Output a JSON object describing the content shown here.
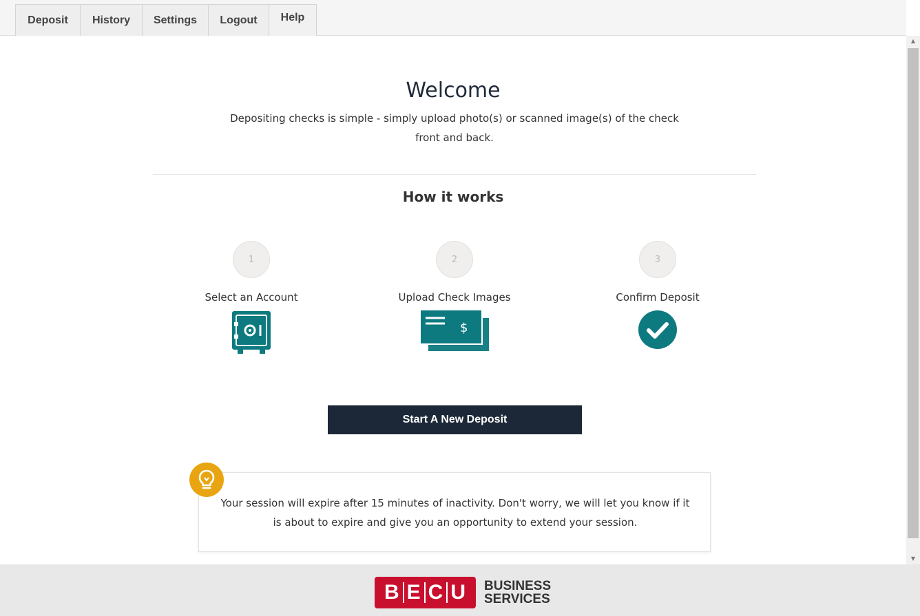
{
  "nav": {
    "tabs": [
      {
        "label": "Deposit"
      },
      {
        "label": "History"
      },
      {
        "label": "Settings"
      },
      {
        "label": "Logout"
      },
      {
        "label": "Help"
      }
    ]
  },
  "welcome": {
    "title": "Welcome",
    "text": "Depositing checks is simple - simply upload photo(s) or scanned image(s) of the check front and back."
  },
  "how_it_works": {
    "title": "How it works",
    "steps": [
      {
        "number": "1",
        "label": "Select an Account",
        "icon": "safe-icon"
      },
      {
        "number": "2",
        "label": "Upload Check Images",
        "icon": "check-images-icon"
      },
      {
        "number": "3",
        "label": "Confirm Deposit",
        "icon": "checkmark-circle-icon"
      }
    ]
  },
  "actions": {
    "start_label": "Start A New Deposit"
  },
  "info": {
    "icon": "lightbulb-icon",
    "text": "Your session will expire after 15 minutes of inactivity. Don't worry, we will let you know if it is about to expire and give you an opportunity to extend your session."
  },
  "footer": {
    "logo_letters": [
      "B",
      "E",
      "C",
      "U"
    ],
    "logo_line1": "BUSINESS",
    "logo_line2": "SERVICES"
  },
  "colors": {
    "accent_teal": "#0d7a80",
    "button_dark": "#1c2838",
    "bulb_yellow": "#e8a511",
    "brand_red": "#c8102e"
  }
}
